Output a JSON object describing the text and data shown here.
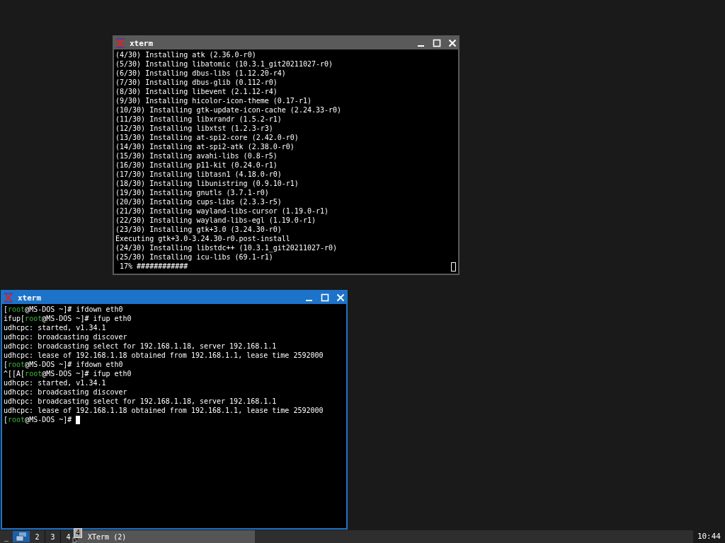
{
  "windows": [
    {
      "title": "xterm",
      "focused": false,
      "cursor_filled": false,
      "lines": [
        {
          "kind": "output",
          "text": "(4/30) Installing atk (2.36.0-r0)"
        },
        {
          "kind": "output",
          "text": "(5/30) Installing libatomic (10.3.1_git20211027-r0)"
        },
        {
          "kind": "output",
          "text": "(6/30) Installing dbus-libs (1.12.20-r4)"
        },
        {
          "kind": "output",
          "text": "(7/30) Installing dbus-glib (0.112-r0)"
        },
        {
          "kind": "output",
          "text": "(8/30) Installing libevent (2.1.12-r4)"
        },
        {
          "kind": "output",
          "text": "(9/30) Installing hicolor-icon-theme (0.17-r1)"
        },
        {
          "kind": "output",
          "text": "(10/30) Installing gtk-update-icon-cache (2.24.33-r0)"
        },
        {
          "kind": "output",
          "text": "(11/30) Installing libxrandr (1.5.2-r1)"
        },
        {
          "kind": "output",
          "text": "(12/30) Installing libxtst (1.2.3-r3)"
        },
        {
          "kind": "output",
          "text": "(13/30) Installing at-spi2-core (2.42.0-r0)"
        },
        {
          "kind": "output",
          "text": "(14/30) Installing at-spi2-atk (2.38.0-r0)"
        },
        {
          "kind": "output",
          "text": "(15/30) Installing avahi-libs (0.8-r5)"
        },
        {
          "kind": "output",
          "text": "(16/30) Installing p11-kit (0.24.0-r1)"
        },
        {
          "kind": "output",
          "text": "(17/30) Installing libtasn1 (4.18.0-r0)"
        },
        {
          "kind": "output",
          "text": "(18/30) Installing libunistring (0.9.10-r1)"
        },
        {
          "kind": "output",
          "text": "(19/30) Installing gnutls (3.7.1-r0)"
        },
        {
          "kind": "output",
          "text": "(20/30) Installing cups-libs (2.3.3-r5)"
        },
        {
          "kind": "output",
          "text": "(21/30) Installing wayland-libs-cursor (1.19.0-r1)"
        },
        {
          "kind": "output",
          "text": "(22/30) Installing wayland-libs-egl (1.19.0-r1)"
        },
        {
          "kind": "output",
          "text": "(23/30) Installing gtk+3.0 (3.24.30-r0)"
        },
        {
          "kind": "output",
          "text": "Executing gtk+3.0-3.24.30-r0.post-install"
        },
        {
          "kind": "output",
          "text": "(24/30) Installing libstdc++ (10.3.1_git20211027-r0)"
        },
        {
          "kind": "output",
          "text": "(25/30) Installing icu-libs (69.1-r1)"
        },
        {
          "kind": "output",
          "text": " 17% ############"
        }
      ]
    },
    {
      "title": "xterm",
      "focused": true,
      "cursor_filled": true,
      "lines": [
        {
          "kind": "prompt",
          "lead": "[",
          "user": "root",
          "rest": "@MS-DOS ~]# ifdown eth0"
        },
        {
          "kind": "prompt",
          "lead": "ifup[",
          "user": "root",
          "rest": "@MS-DOS ~]# ifup eth0"
        },
        {
          "kind": "output",
          "text": "udhcpc: started, v1.34.1"
        },
        {
          "kind": "output",
          "text": "udhcpc: broadcasting discover"
        },
        {
          "kind": "output",
          "text": "udhcpc: broadcasting select for 192.168.1.18, server 192.168.1.1"
        },
        {
          "kind": "output",
          "text": "udhcpc: lease of 192.168.1.18 obtained from 192.168.1.1, lease time 2592000"
        },
        {
          "kind": "prompt",
          "lead": "[",
          "user": "root",
          "rest": "@MS-DOS ~]# ifdown eth0"
        },
        {
          "kind": "prompt",
          "lead": "^[[A[",
          "user": "root",
          "rest": "@MS-DOS ~]# ifup eth0"
        },
        {
          "kind": "output",
          "text": "udhcpc: started, v1.34.1"
        },
        {
          "kind": "output",
          "text": "udhcpc: broadcasting discover"
        },
        {
          "kind": "output",
          "text": "udhcpc: broadcasting select for 192.168.1.18, server 192.168.1.1"
        },
        {
          "kind": "output",
          "text": "udhcpc: lease of 192.168.1.18 obtained from 192.168.1.1, lease time 2592000"
        },
        {
          "kind": "prompt",
          "lead": "[",
          "user": "root",
          "rest": "@MS-DOS ~]#"
        }
      ]
    }
  ],
  "taskbar": {
    "menu": "_",
    "workspaces": [
      {
        "label": "2",
        "selected": false
      },
      {
        "label": "3",
        "selected": false
      },
      {
        "label": "4",
        "selected": false
      }
    ],
    "tooltip": "4",
    "task": "XTerm (2)",
    "clock": "10:44"
  }
}
